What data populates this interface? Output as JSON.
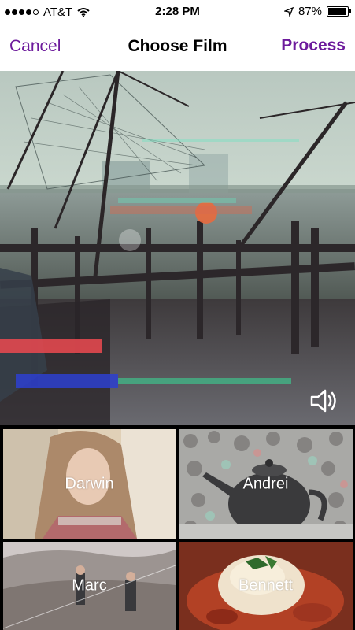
{
  "status_bar": {
    "carrier": "AT&T",
    "time": "2:28 PM",
    "battery": "87%",
    "icons": [
      "signal-dots",
      "wifi-icon",
      "location-arrow-icon",
      "battery-icon"
    ]
  },
  "nav": {
    "cancel_label": "Cancel",
    "title": "Choose Film",
    "process_label": "Process"
  },
  "preview": {
    "sound_icon": "speaker-icon"
  },
  "films": [
    {
      "label": "Darwin"
    },
    {
      "label": "Andrei"
    },
    {
      "label": "Marc"
    },
    {
      "label": "Bennett"
    }
  ],
  "colors": {
    "accent": "#6d1b9c"
  }
}
